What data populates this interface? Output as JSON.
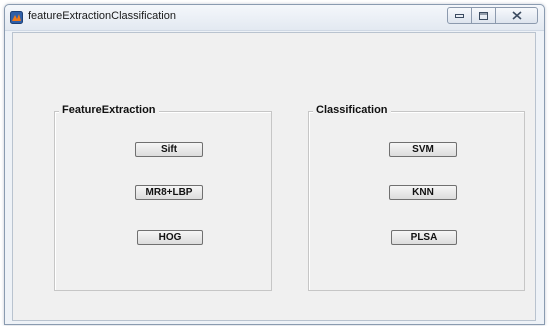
{
  "window": {
    "title": "featureExtractionClassification"
  },
  "feature_extraction": {
    "title": "FeatureExtraction",
    "sift_label": "Sift",
    "mr8lbp_label": "MR8+LBP",
    "hog_label": "HOG"
  },
  "classification": {
    "title": "Classification",
    "svm_label": "SVM",
    "knn_label": "KNN",
    "plsa_label": "PLSA"
  }
}
